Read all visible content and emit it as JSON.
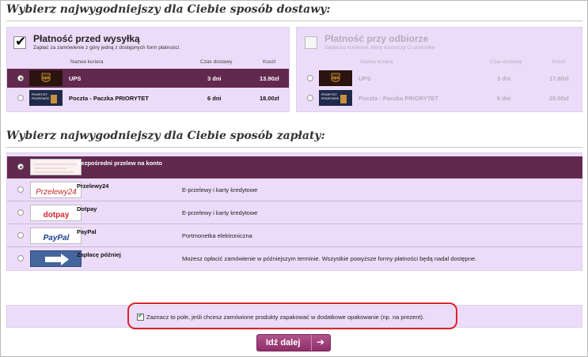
{
  "delivery": {
    "heading": "Wybierz najwygodniejszy dla Ciebie sposób dostawy:",
    "prepaid": {
      "title": "Płatność przed wysyłką",
      "subtitle": "Zapłać za zamówienie z góry jedną z dostępnych form płatności.",
      "checked": true,
      "columns": {
        "courier": "Nazwa kuriera",
        "time": "Czas dostawy",
        "cost": "Koszt"
      },
      "rows": [
        {
          "logo": "ups-logo",
          "name": "UPS",
          "time": "3 dni",
          "cost": "13.90zł",
          "selected": true
        },
        {
          "logo": "poczta-priorytet-logo",
          "name": "Poczta - Paczka PRIORYTET",
          "time": "6 dni",
          "cost": "18.00zł",
          "selected": false
        }
      ]
    },
    "cod": {
      "title": "Płatność przy odbiorze",
      "subtitle": "Zapłacisz kurierowi, który dostarczy Ci przesyłkę",
      "checked": false,
      "columns": {
        "courier": "Nazwa kuriera",
        "time": "Czas dostawy",
        "cost": "Koszt"
      },
      "rows": [
        {
          "logo": "ups-logo",
          "name": "UPS",
          "time": "3 dni",
          "cost": "17.90zł",
          "selected": false
        },
        {
          "logo": "poczta-priorytet-logo",
          "name": "Poczta - Paczka PRIORYTET",
          "time": "6 dni",
          "cost": "20.00zł",
          "selected": false
        }
      ]
    }
  },
  "payment": {
    "heading": "Wybierz najwygodniejszy dla Ciebie sposób zapłaty:",
    "methods": [
      {
        "logo": "bank-transfer-logo",
        "name": "Bezpośredni przelew na konto",
        "desc": "",
        "selected": true
      },
      {
        "logo": "przelewy24-logo",
        "logo_text": "Przelewy24",
        "name": "Przelewy24",
        "desc": "E-przelewy i karty kredytowe",
        "selected": false
      },
      {
        "logo": "dotpay-logo",
        "logo_text": "dotpay",
        "name": "Dotpay",
        "desc": "E-przelewy i karty kredytowe",
        "selected": false
      },
      {
        "logo": "paypal-logo",
        "logo_text": "PayPal",
        "name": "PayPal",
        "desc": "Portmonetka elektroniczna",
        "selected": false
      },
      {
        "logo": "arrow-icon",
        "name": "Zapłacę później",
        "desc": "Możesz opłacić zamówienie w późniejszym terminie. Wszystkie powyższe formy płatności będą nadal dostępne.",
        "selected": false
      }
    ]
  },
  "gift_wrap": {
    "label": "Zaznacz to pole, jeśli chcesz zamówione produkty zapakować w dodatkowe opakowanie (np. na prezent).",
    "checked": true
  },
  "next_button": {
    "label": "Idź dalej"
  },
  "colors": {
    "panel": "#eddcf9",
    "selected_row": "#62294f",
    "button": "#9b3c78",
    "highlight": "#d9262b"
  }
}
